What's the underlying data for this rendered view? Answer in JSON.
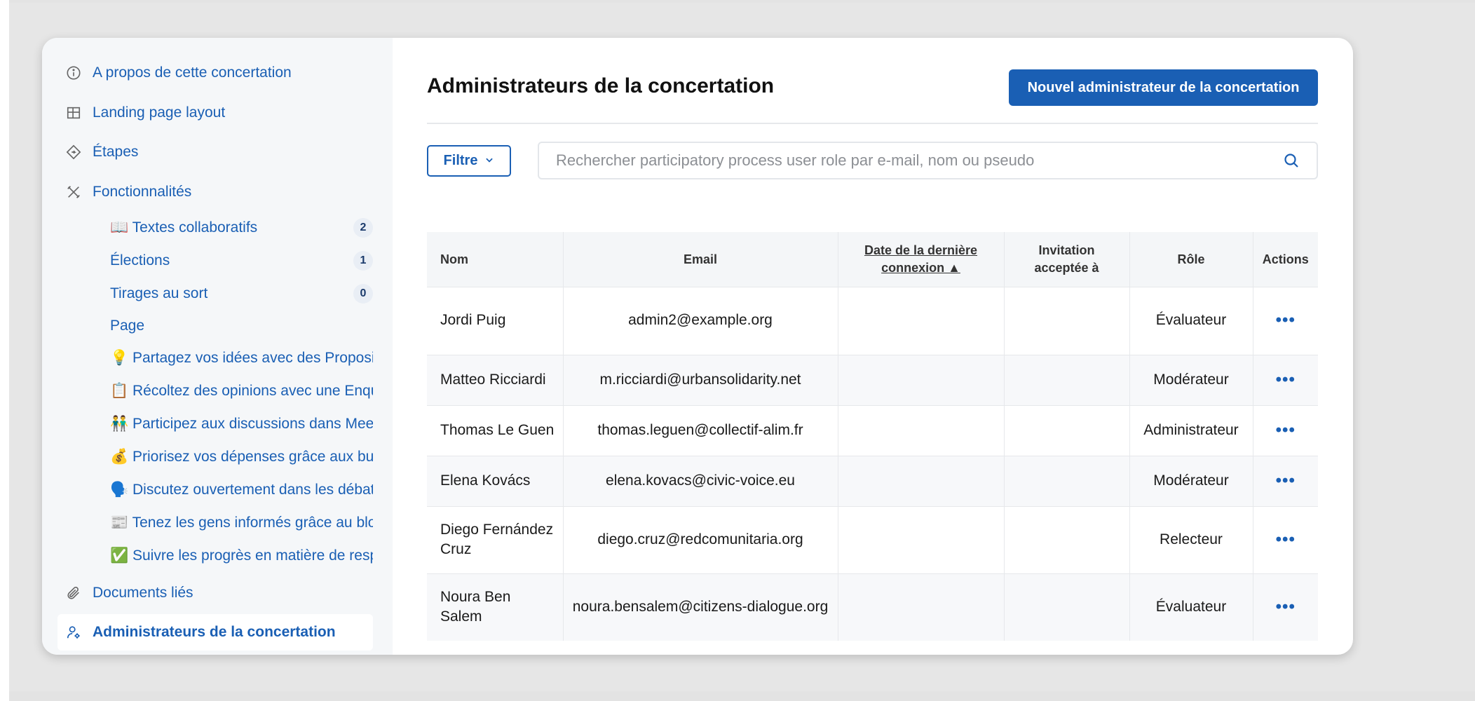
{
  "sidebar": {
    "items": [
      {
        "label": "A propos de cette concertation",
        "icon": "info-icon"
      },
      {
        "label": "Landing page layout",
        "icon": "layout-icon"
      },
      {
        "label": "Étapes",
        "icon": "steps-icon"
      },
      {
        "label": "Fonctionnalités",
        "icon": "tools-icon"
      }
    ],
    "features": [
      {
        "label": "📖 Textes collaboratifs",
        "count": "2"
      },
      {
        "label": "Élections",
        "count": "1"
      },
      {
        "label": "Tirages au sort",
        "count": "0"
      },
      {
        "label": "Page"
      },
      {
        "label": "💡 Partagez vos idées avec des Propositions"
      },
      {
        "label": "📋 Récoltez des opinions avec une Enquête"
      },
      {
        "label": "👬 Participez aux discussions dans Meetings"
      },
      {
        "label": "💰 Priorisez vos dépenses grâce aux budgets"
      },
      {
        "label": "🗣️ Discutez ouvertement dans les débats"
      },
      {
        "label": "📰 Tenez les gens informés grâce au blog"
      },
      {
        "label": "✅ Suivre les progrès en matière de responsabilité"
      }
    ],
    "documents": {
      "label": "Documents liés",
      "icon": "paperclip-icon"
    },
    "admins": {
      "label": "Administrateurs de la concertation",
      "icon": "user-gear-icon"
    }
  },
  "main": {
    "title": "Administrateurs de la concertation",
    "new_button": "Nouvel administrateur de la concertation",
    "filter_label": "Filtre",
    "search": {
      "placeholder": "Rechercher participatory process user role par e-mail, nom ou pseudo",
      "value": ""
    },
    "table": {
      "headers": {
        "name": "Nom",
        "email": "Email",
        "last_login": "Date de la dernière connexion ▲",
        "invitation": "Invitation acceptée à",
        "role": "Rôle",
        "actions": "Actions"
      },
      "rows": [
        {
          "name": "Jordi Puig",
          "email": "admin2@example.org",
          "last_login": "",
          "invitation": "",
          "role": "Évaluateur",
          "actions": "•••"
        },
        {
          "name": "Matteo Ricciardi",
          "email": "m.ricciardi@urbansolidarity.net",
          "last_login": "",
          "invitation": "",
          "role": "Modérateur",
          "actions": "•••"
        },
        {
          "name": "Thomas Le Guen",
          "email": "thomas.leguen@collectif-alim.fr",
          "last_login": "",
          "invitation": "",
          "role": "Administrateur",
          "actions": "•••"
        },
        {
          "name": "Elena Kovács",
          "email": "elena.kovacs@civic-voice.eu",
          "last_login": "",
          "invitation": "",
          "role": "Modérateur",
          "actions": "•••"
        },
        {
          "name": "Diego Fernández Cruz",
          "email": "diego.cruz@redcomunitaria.org",
          "last_login": "",
          "invitation": "",
          "role": "Relecteur",
          "actions": "•••"
        },
        {
          "name": "Noura Ben Salem",
          "email": "noura.bensalem@citizens-dialogue.org",
          "last_login": "",
          "invitation": "",
          "role": "Évaluateur",
          "actions": "•••"
        }
      ]
    }
  },
  "colors": {
    "accent": "#1a5fb4",
    "sidebar_bg": "#f5f7f9",
    "page_bg": "#e3e3e3"
  }
}
